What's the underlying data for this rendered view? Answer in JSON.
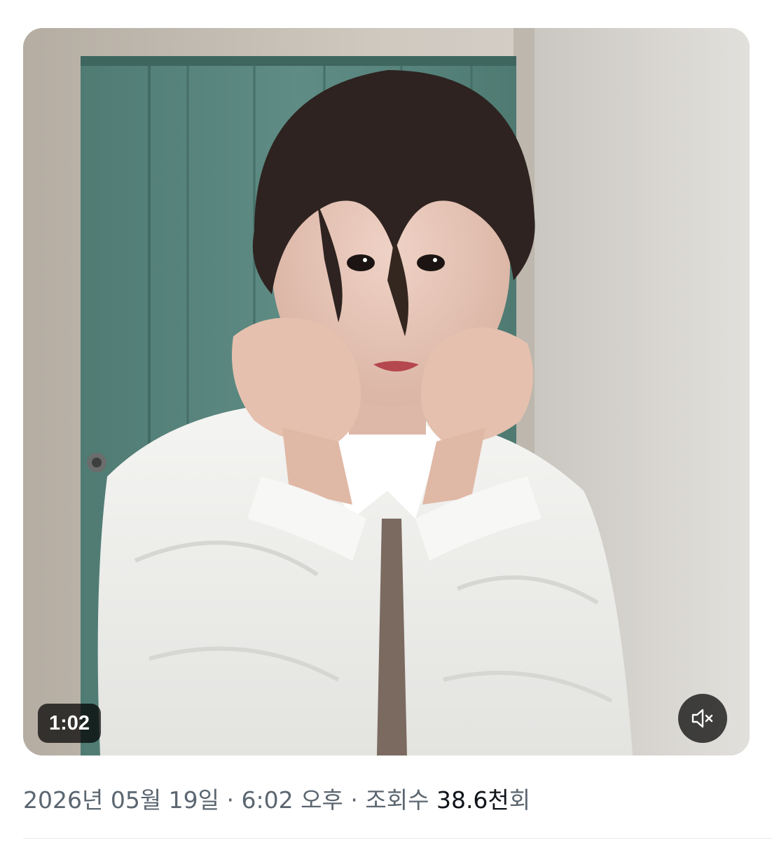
{
  "video": {
    "duration": "1:02",
    "mute_icon": "speaker-muted-icon"
  },
  "meta": {
    "date": "2026년 05월 19일",
    "separator": "·",
    "time": "6:02 오후",
    "views_label": "조회수",
    "views_count": "38.6천",
    "views_suffix": "회"
  },
  "colors": {
    "meta_text": "#5b6670",
    "views_text": "#0f1419",
    "badge_background": "#000000",
    "badge_text": "#ffffff"
  }
}
